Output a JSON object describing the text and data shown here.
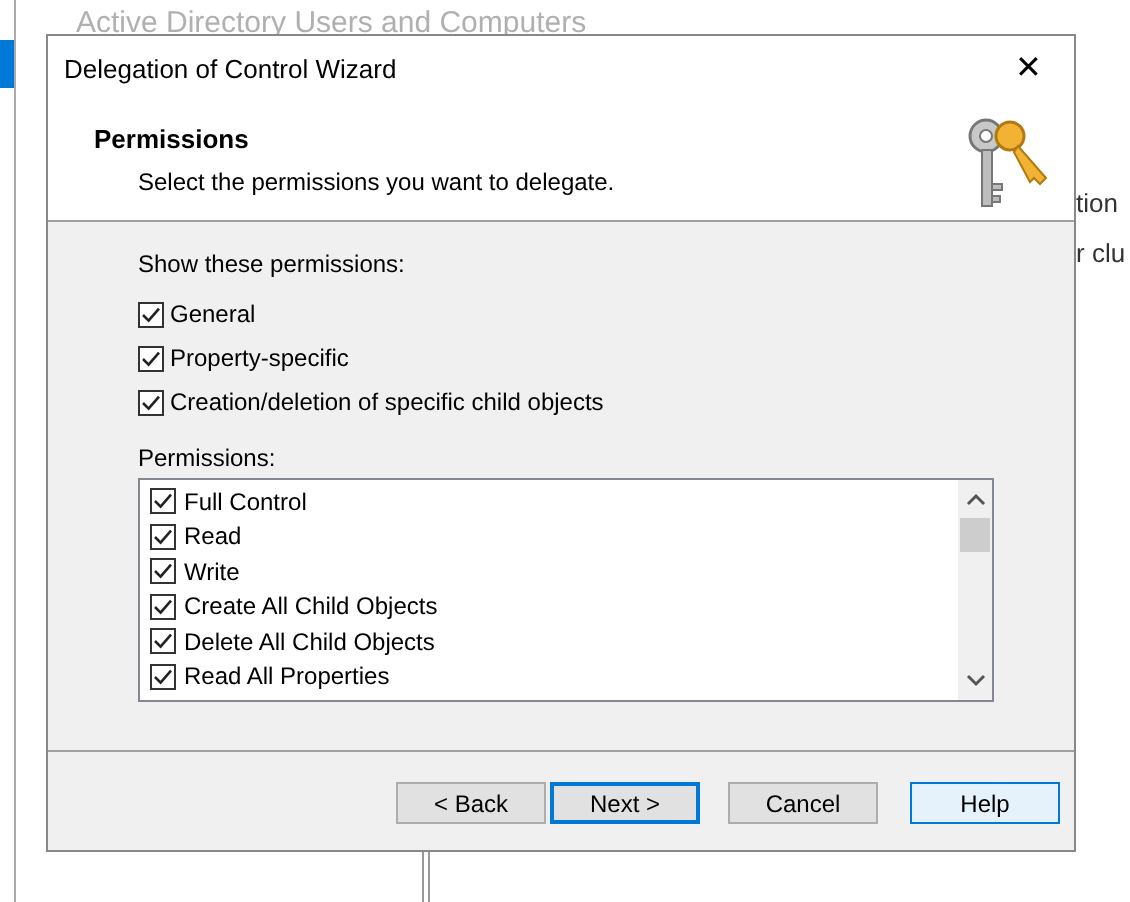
{
  "background_window": {
    "title": "Active Directory Users and Computers",
    "fragments": [
      "tion",
      "r clu"
    ]
  },
  "dialog": {
    "title": "Delegation of Control Wizard",
    "close": "✕",
    "heading": "Permissions",
    "subheading": "Select the permissions you want to delegate.",
    "show_label": "Show these permissions:",
    "filters": [
      {
        "label": "General",
        "checked": true
      },
      {
        "label": "Property-specific",
        "checked": true
      },
      {
        "label": "Creation/deletion of specific child objects",
        "checked": true
      }
    ],
    "list_label": "Permissions:",
    "permissions": [
      {
        "label": "Full Control",
        "checked": true
      },
      {
        "label": "Read",
        "checked": true
      },
      {
        "label": "Write",
        "checked": true
      },
      {
        "label": "Create All Child Objects",
        "checked": true
      },
      {
        "label": "Delete All Child Objects",
        "checked": true
      },
      {
        "label": "Read All Properties",
        "checked": true
      }
    ],
    "buttons": [
      {
        "label": "< Back",
        "kind": "normal"
      },
      {
        "label": "Next >",
        "kind": "default"
      },
      {
        "label": "Cancel",
        "kind": "normal"
      },
      {
        "label": "Help",
        "kind": "focused"
      }
    ]
  }
}
